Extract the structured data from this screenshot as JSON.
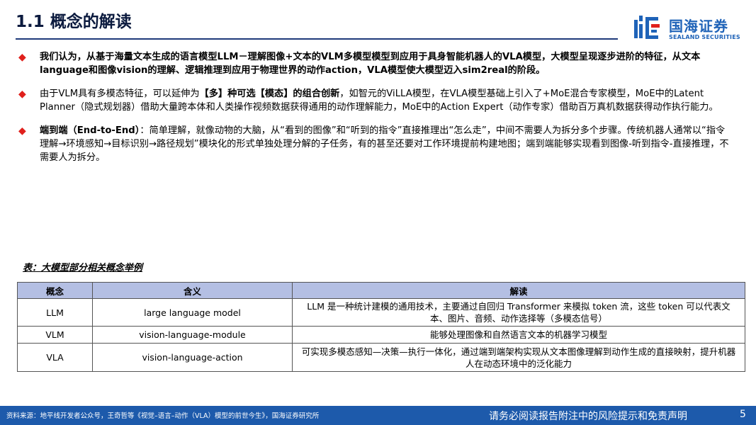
{
  "header": {
    "title": "1.1 概念的解读",
    "logo_cn": "国海证券",
    "logo_en": "SEALAND SECURITIES",
    "brand_color": "#1f63b8",
    "bullet_color": "#e0201c"
  },
  "bullets": {
    "b1": "我们认为，从基于海量文本生成的语言模型LLM－理解图像+文本的VLM多模型模型到应用于具身智能机器人的VLA模型，大模型呈现逐步进阶的特征，从文本language和图像vision的理解、逻辑推理到应用于物理世界的动作action，VLA模型使大模型迈入sim2real的阶段。",
    "b2_pre": "由于VLM具有多模态特征，可以延伸为",
    "b2_bold": "【多】种可选【模态】的组合创新",
    "b2_post": "，如智元的ViLLA模型，在VLA模型基础上引入了+MoE混合专家模型，MoE中的Latent Planner（隐式规划器）借助大量跨本体和人类操作视频数据获得通用的动作理解能力，MoE中的Action Expert（动作专家）借助百万真机数据获得动作执行能力。",
    "b3_bold": "端到端（End-to-End）",
    "b3_post": "：简单理解，就像动物的大脑，从“看到的图像”和“听到的指令”直接推理出“怎么走”，中间不需要人为拆分多个步骤。传统机器人通常以“指令理解→环境感知→目标识别→路径规划”模块化的形式单独处理分解的子任务，有的甚至还要对工作环境提前构建地图；端到端能够实现看到图像-听到指令-直接推理，不需要人为拆分。"
  },
  "table": {
    "caption": "表：大模型部分相关概念举例",
    "headers": [
      "概念",
      "含义",
      "解读"
    ],
    "rows": [
      [
        "LLM",
        "large language model",
        "LLM 是一种统计建模的通用技术，主要通过自回归 Transformer 来模拟 token 流，这些 token 可以代表文本、图片、音频、动作选择等（多模态信号）"
      ],
      [
        "VLM",
        "vision-language-module",
        "能够处理图像和自然语言文本的机器学习模型"
      ],
      [
        "VLA",
        "vision-language-action",
        "可实现多模态感知—决策—执行一体化，通过端到端架构实现从文本图像理解到动作生成的直接映射，提升机器人在动态环境中的泛化能力"
      ]
    ]
  },
  "footer": {
    "source": "资料来源：地平线开发者公众号，王奇哲等《视觉–语言–动作（VLA）模型的前世今生》，国海证券研究所",
    "disclaimer": "请务必阅读报告附注中的风险提示和免责声明",
    "page": "5",
    "bg_color": "#1d5aab"
  }
}
